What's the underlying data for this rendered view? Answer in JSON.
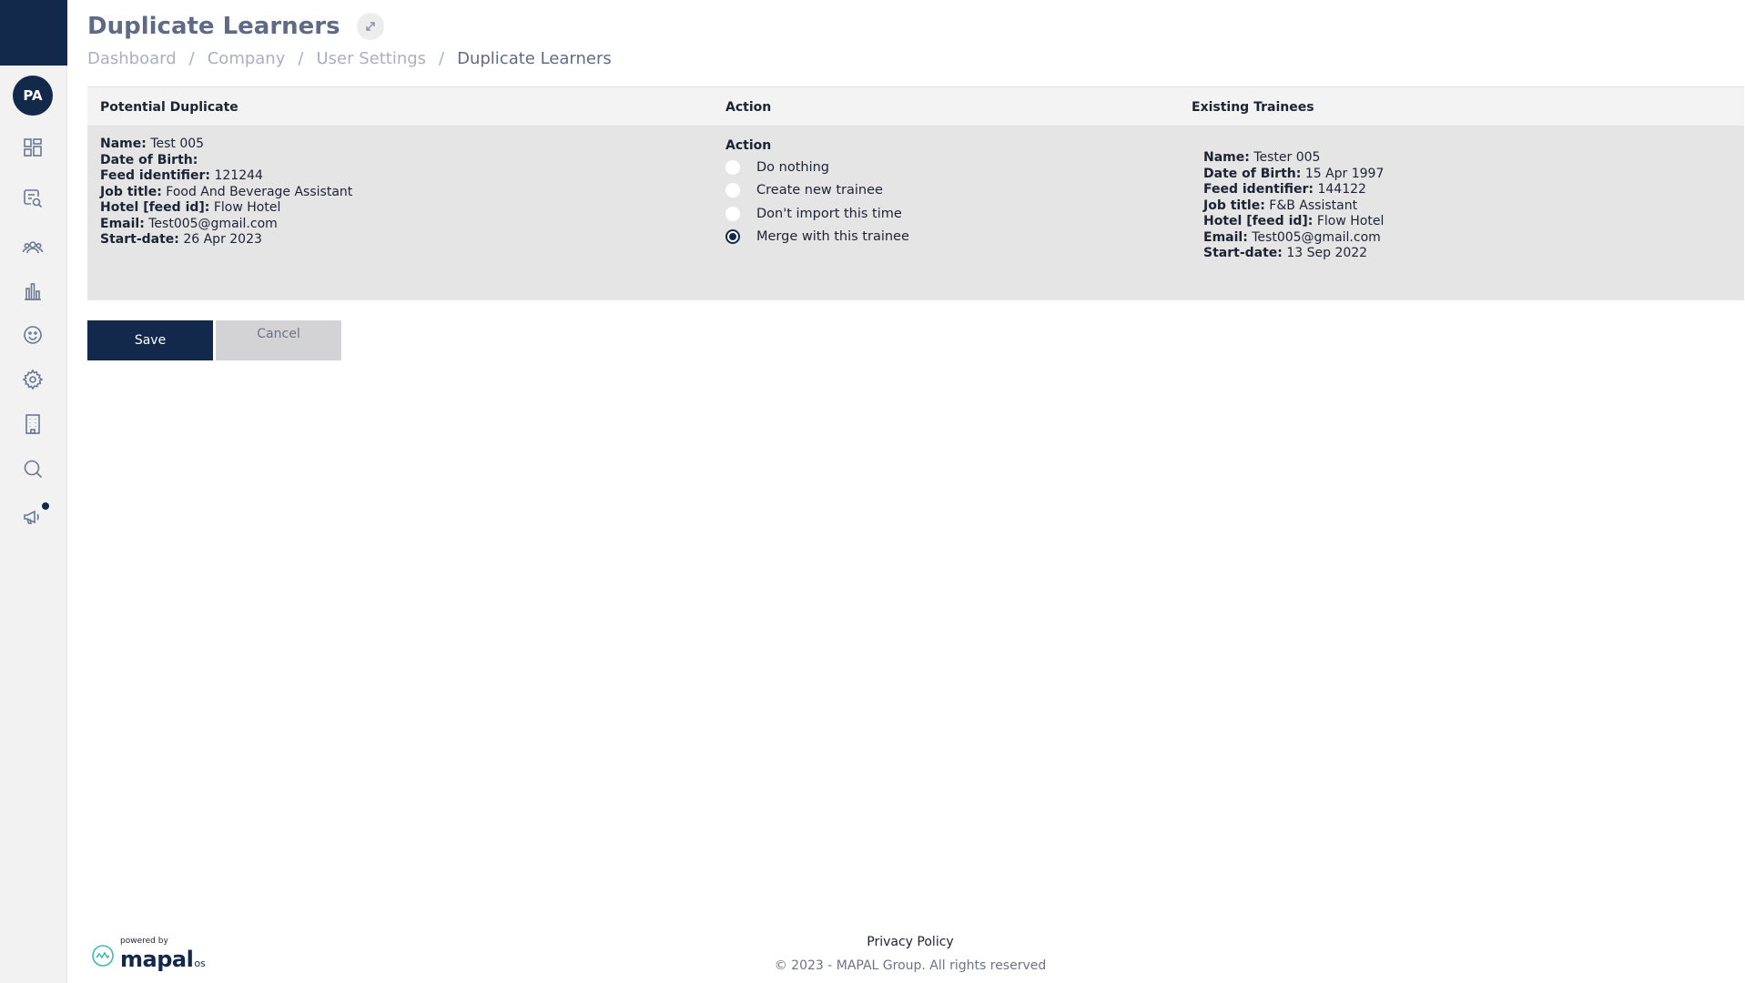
{
  "sidebar": {
    "avatar_initials": "PA",
    "items": [
      {
        "icon": "dashboard-icon"
      },
      {
        "icon": "search-document-icon"
      },
      {
        "icon": "users-icon"
      },
      {
        "icon": "bar-chart-icon"
      },
      {
        "icon": "smiley-icon"
      },
      {
        "icon": "gear-icon"
      },
      {
        "icon": "building-icon"
      },
      {
        "icon": "search-icon"
      },
      {
        "icon": "megaphone-icon"
      }
    ]
  },
  "header": {
    "title": "Duplicate Learners",
    "breadcrumb": [
      "Dashboard",
      "Company",
      "User Settings",
      "Duplicate Learners"
    ]
  },
  "table": {
    "headers": {
      "potential": "Potential Duplicate",
      "action": "Action",
      "existing": "Existing Trainees"
    },
    "labels": {
      "name": "Name:",
      "dob": "Date of Birth:",
      "feed": "Feed identifier:",
      "job": "Job title:",
      "hotel": "Hotel [feed id]:",
      "email": "Email:",
      "start": "Start-date:"
    },
    "potential": {
      "name": "Test 005",
      "dob": "",
      "feed": "121244",
      "job": "Food And Beverage Assistant",
      "hotel": "Flow Hotel",
      "email": "Test005@gmail.com",
      "start": "26 Apr 2023"
    },
    "action": {
      "title": "Action",
      "options": [
        "Do nothing",
        "Create new trainee",
        "Don't import this time",
        "Merge with this trainee"
      ],
      "selected": "Merge with this trainee"
    },
    "existing": {
      "name": "Tester 005",
      "dob": "15 Apr 1997",
      "feed": "144122",
      "job": "F&B Assistant",
      "hotel": "Flow Hotel",
      "email": "Test005@gmail.com",
      "start": "13 Sep 2022"
    }
  },
  "buttons": {
    "save": "Save",
    "cancel": "Cancel"
  },
  "footer": {
    "powered_by": "powered by",
    "brand": "mapal",
    "brand_suffix": "os",
    "privacy": "Privacy Policy",
    "copyright": "© 2023 - MAPAL Group. All rights reserved"
  },
  "colors": {
    "navy": "#13294b",
    "title": "#5f6b86",
    "breadcrumb": "#a9b0c0",
    "row_bg": "#e5e5e6",
    "head_bg": "#f3f3f4"
  }
}
